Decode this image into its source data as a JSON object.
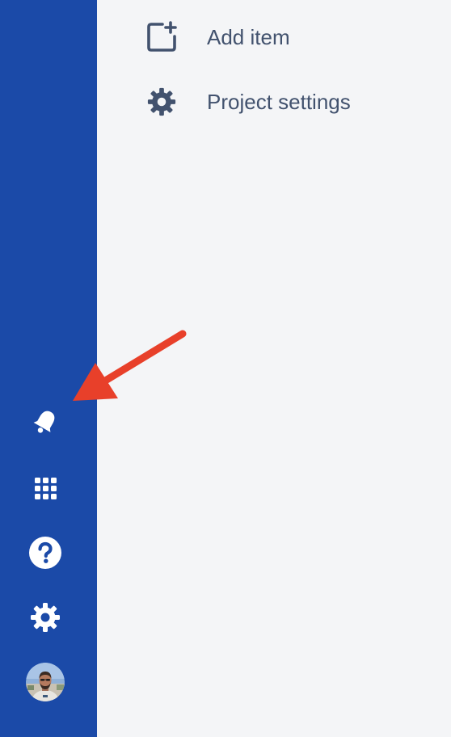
{
  "menu": {
    "items": [
      {
        "label": "Add item",
        "icon": "add-item-icon"
      },
      {
        "label": "Project settings",
        "icon": "gear-icon"
      }
    ]
  },
  "sidebar": {
    "icons": [
      "bell-icon",
      "app-grid-icon",
      "help-icon",
      "gear-icon",
      "avatar"
    ]
  },
  "colors": {
    "sidebar_bg": "#1b4aa8",
    "main_bg": "#f4f5f7",
    "text": "#42526e",
    "arrow": "#e8402a"
  }
}
